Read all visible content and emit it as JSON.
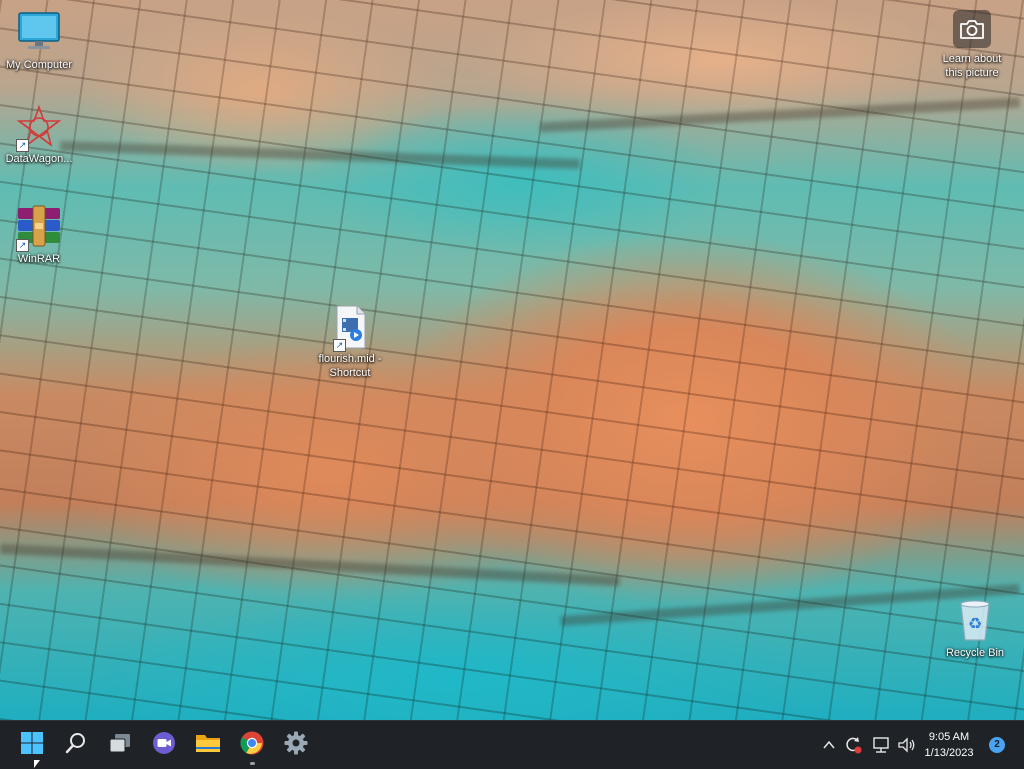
{
  "desktop": {
    "icons": [
      {
        "label": "My Computer",
        "icon": "monitor-icon"
      },
      {
        "label": "DataWagon...",
        "icon": "datawagon-star-icon"
      },
      {
        "label": "WinRAR",
        "icon": "winrar-books-icon"
      },
      {
        "label": "flourish.mid - Shortcut",
        "icon": "media-file-icon"
      },
      {
        "label": "Recycle Bin",
        "icon": "recycle-bin-icon"
      }
    ],
    "learn_about_picture": "Learn about this picture"
  },
  "taskbar": {
    "buttons": [
      {
        "name": "start",
        "icon": "windows-logo-icon"
      },
      {
        "name": "search",
        "icon": "search-icon"
      },
      {
        "name": "task-view",
        "icon": "task-view-icon"
      },
      {
        "name": "chat",
        "icon": "chat-camera-icon"
      },
      {
        "name": "file-explorer",
        "icon": "folder-icon"
      },
      {
        "name": "chrome",
        "icon": "chrome-icon"
      },
      {
        "name": "settings",
        "icon": "gear-icon"
      }
    ],
    "tray": {
      "time": "9:05 AM",
      "date": "1/13/2023",
      "notification_count": "2"
    }
  },
  "colors": {
    "taskbar_bg": "#1f2327",
    "accent_blue": "#4aa3f0"
  }
}
